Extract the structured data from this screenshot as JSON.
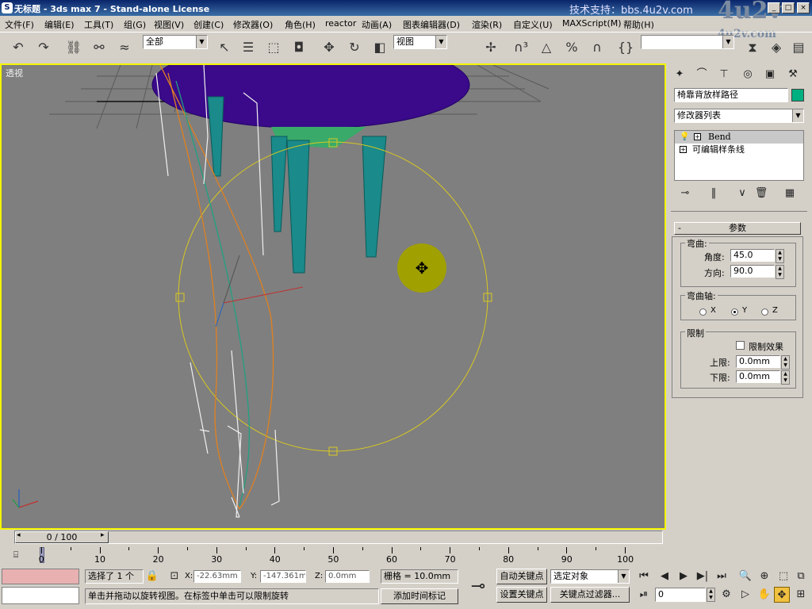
{
  "window": {
    "title": "无标题 - 3ds max 7 - Stand-alone License",
    "support_text": "技术支持：bbs.4u2v.com",
    "watermark": "4u2v",
    "watermark_url": "4u2v.com"
  },
  "menu": [
    "文件(F)",
    "编辑(E)",
    "工具(T)",
    "组(G)",
    "视图(V)",
    "创建(C)",
    "修改器(O)",
    "角色(H)",
    "reactor",
    "动画(A)",
    "图表编辑器(D)",
    "渲染(R)",
    "自定义(U)",
    "MAXScript(M)",
    "帮助(H)"
  ],
  "toolbar": {
    "selection_filter": "全部",
    "ref_coord": "视图",
    "named_selection": ""
  },
  "viewport": {
    "label": "透视",
    "colors": {
      "border": "#f5f500",
      "bg": "#7f7f7f",
      "table_top": "#3a0a8a",
      "legs": "#1a8a8a"
    }
  },
  "command_panel": {
    "object_name": "椅靠背放样路径",
    "object_color": "#00b080",
    "modifier_list": "修改器列表",
    "stack": [
      {
        "label": "Bend",
        "selected": true
      },
      {
        "label": "可编辑样条线",
        "selected": false
      }
    ],
    "rollout_title": "参数",
    "bend_group": "弯曲:",
    "angle_label": "角度:",
    "angle_value": "45.0",
    "direction_label": "方向:",
    "direction_value": "90.0",
    "axis_group": "弯曲轴:",
    "axis_x": "X",
    "axis_y": "Y",
    "axis_z": "Z",
    "selected_axis": "Y",
    "limit_group": "限制",
    "limit_effect": "限制效果",
    "upper_label": "上限:",
    "upper_value": "0.0mm",
    "lower_label": "下限:",
    "lower_value": "0.0mm"
  },
  "timeline": {
    "slider": "0 / 100",
    "current": 0,
    "total": 100,
    "ticks": [
      "0",
      "10",
      "20",
      "30",
      "40",
      "50",
      "60",
      "70",
      "80",
      "90",
      "100"
    ]
  },
  "status": {
    "selected": "选择了 1 个",
    "x_label": "X:",
    "x_value": "-22.63mm",
    "y_label": "Y:",
    "y_value": "-147.361m",
    "z_label": "Z:",
    "z_value": "0.0mm",
    "grid": "栅格 = 10.0mm",
    "prompt": "单击并拖动以旋转视图。在标签中单击可以限制旋转",
    "add_time_tag": "添加时间标记",
    "auto_key": "自动关键点",
    "set_key": "设置关键点",
    "key_mode": "选定对象",
    "key_filters": "关键点过滤器...",
    "frame": "0"
  }
}
